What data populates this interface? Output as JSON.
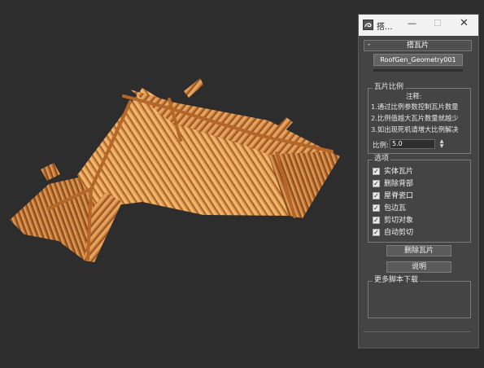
{
  "window": {
    "title": "搭...",
    "minimize_glyph": "—",
    "maximize_glyph": "☐",
    "close_glyph": "✕"
  },
  "rollout": {
    "toggle": "-",
    "title": "搭瓦片",
    "geometry_button": "RoofGen_Geometry001"
  },
  "ratio_group": {
    "title": "瓦片比例",
    "notes": [
      "注释:",
      "1.通过比例参数控制瓦片数量",
      "2.比例值越大瓦片数量就越少",
      "3.如出现死机请增大比例解决"
    ],
    "ratio_label": "比例:",
    "ratio_value": "5.0"
  },
  "options_group": {
    "title": "选项",
    "items": [
      {
        "label": "实体瓦片",
        "checked": true
      },
      {
        "label": "删除背部",
        "checked": true
      },
      {
        "label": "屋脊瓷口",
        "checked": true
      },
      {
        "label": "包边瓦",
        "checked": true
      },
      {
        "label": "剪切对象",
        "checked": true
      },
      {
        "label": "自动剪切",
        "checked": true
      }
    ]
  },
  "buttons": {
    "delete_tiles": "删除瓦片",
    "help": "说明"
  },
  "more_group": {
    "title": "更多脚本下载"
  },
  "colors": {
    "viewport_bg": "#2d2d2d",
    "panel_bg": "#444444",
    "tile_light": "#e3a35a",
    "tile_dark": "#8a4f22",
    "tile_mid": "#c77b3b"
  }
}
